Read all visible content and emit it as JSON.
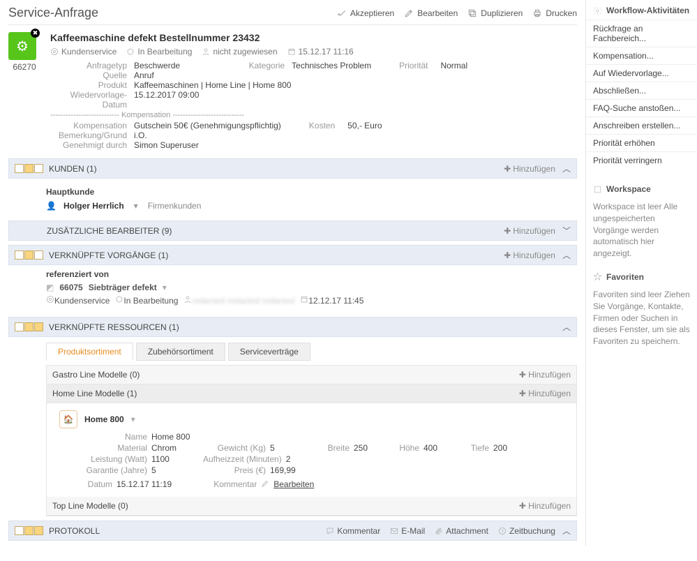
{
  "header": {
    "title": "Service-Anfrage",
    "actions": {
      "accept": "Akzeptieren",
      "edit": "Bearbeiten",
      "duplicate": "Duplizieren",
      "print": "Drucken"
    }
  },
  "record": {
    "id": "66270",
    "title": "Kaffeemaschine defekt Bestellnummer 23432",
    "meta": {
      "type": "Kundenservice",
      "status": "In Bearbeitung",
      "assigned": "nicht zugewiesen",
      "datetime": "15.12.17 11:16"
    },
    "fields": {
      "anfragetyp_k": "Anfragetyp",
      "anfragetyp_v": "Beschwerde",
      "kategorie_k": "Kategorie",
      "kategorie_v": "Technisches Problem",
      "prio_k": "Priorität",
      "prio_v": "Normal",
      "quelle_k": "Quelle",
      "quelle_v": "Anruf",
      "produkt_k": "Produkt",
      "produkt_v": "Kaffeemaschinen | Home Line | Home 800",
      "wieder_k": "Wiedervorlage-Datum",
      "wieder_v": "15.12.2017 09:00"
    },
    "komp": {
      "sep": "--------------------------- Kompensation ----------------------------",
      "komp_k": "Kompensation",
      "komp_v": "Gutschein 50€ (Genehmigungspflichtig)",
      "kosten_k": "Kosten",
      "kosten_v": "50,- Euro",
      "bemerk_k": "Bemerkung/Grund",
      "bemerk_v": "i.O.",
      "genehm_k": "Genehmigt durch",
      "genehm_v": "Simon Superuser"
    }
  },
  "sections": {
    "kunden": {
      "title": "KUNDEN (1)",
      "add": "Hinzufügen",
      "sub": "Hauptkunde",
      "name": "Holger Herrlich",
      "kind": "Firmenkunden"
    },
    "zusatz": {
      "title": "ZUSÄTZLICHE BEARBEITER (9)",
      "add": "Hinzufügen"
    },
    "verk": {
      "title": "VERKNÜPFTE VORGÄNGE (1)",
      "add": "Hinzufügen",
      "refby": "referenziert von",
      "item": {
        "id": "66075",
        "name": "Siebträger defekt",
        "type": "Kundenservice",
        "status": "In Bearbeitung",
        "hidden": "redacted redacted redacted",
        "date": "12.12.17 11:45"
      }
    },
    "res": {
      "title": "VERKNÜPFTE RESSOURCEN (1)",
      "tabs": {
        "t1": "Produktsortiment",
        "t2": "Zubehörsortiment",
        "t3": "Serviceverträge"
      },
      "rows": {
        "r1": "Gastro Line Modelle (0)",
        "r2": "Home Line Modelle (1)",
        "r3": "Top Line Modelle (0)",
        "add": "Hinzufügen"
      },
      "product": {
        "name_lbl": "Name",
        "name": "Home 800",
        "material_lbl": "Material",
        "material": "Chrom",
        "gewicht_lbl": "Gewicht (Kg)",
        "gewicht": "5",
        "breite_lbl": "Breite",
        "breite": "250",
        "hoehe_lbl": "Höhe",
        "hoehe": "400",
        "tiefe_lbl": "Tiefe",
        "tiefe": "200",
        "leistung_lbl": "Leistung (Watt)",
        "leistung": "1100",
        "aufheiz_lbl": "Aufheizzeit (Minuten)",
        "aufheiz": "2",
        "garantie_lbl": "Garantie (Jahre)",
        "garantie": "5",
        "preis_lbl": "Preis (€)",
        "preis": "169,99",
        "datum_lbl": "Datum",
        "datum": "15.12.17 11:19",
        "komm_lbl": "Kommentar",
        "edit": "Bearbeiten"
      }
    },
    "proto": {
      "title": "PROTOKOLL",
      "comment": "Kommentar",
      "email": "E-Mail",
      "attach": "Attachment",
      "time": "Zeitbuchung"
    }
  },
  "sidebar": {
    "workflow": {
      "title": "Workflow-Aktivitäten",
      "items": [
        "Rückfrage an Fachbereich...",
        "Kompensation...",
        "Auf Wiedervorlage...",
        "Abschließen...",
        "FAQ-Suche anstoßen...",
        "Anschreiben erstellen...",
        "Priorität erhöhen",
        "Priorität verringern"
      ]
    },
    "workspace": {
      "title": "Workspace",
      "text": "Workspace ist leer\nAlle ungespeicherten Vorgänge werden automatisch hier angezeigt."
    },
    "fav": {
      "title": "Favoriten",
      "text": "Favoriten sind leer\nZiehen Sie Vorgänge, Kontakte, Firmen oder Suchen in dieses Fenster, um sie als Favoriten zu speichern."
    }
  }
}
